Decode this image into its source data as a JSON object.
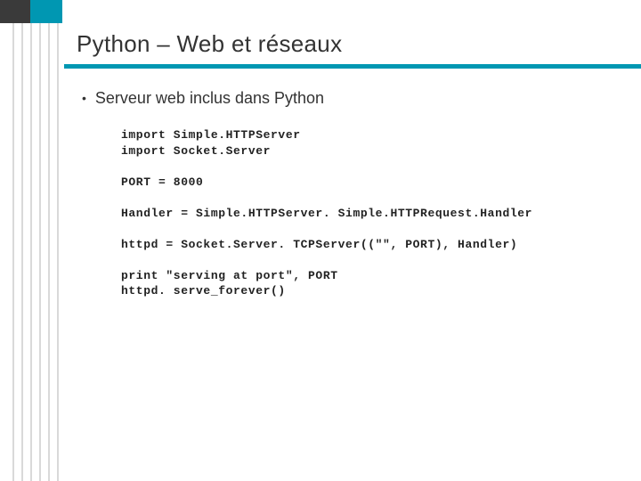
{
  "title": "Python – Web et réseaux",
  "bullet1": "Serveur web inclus dans Python",
  "code": {
    "l1": "import Simple.HTTPServer",
    "l2": "import Socket.Server",
    "l3": "PORT = 8000",
    "l4": "Handler = Simple.HTTPServer. Simple.HTTPRequest.Handler",
    "l5": "httpd = Socket.Server. TCPServer((\"\", PORT), Handler)",
    "l6": "print \"serving at port\", PORT",
    "l7": "httpd. serve_forever()"
  }
}
